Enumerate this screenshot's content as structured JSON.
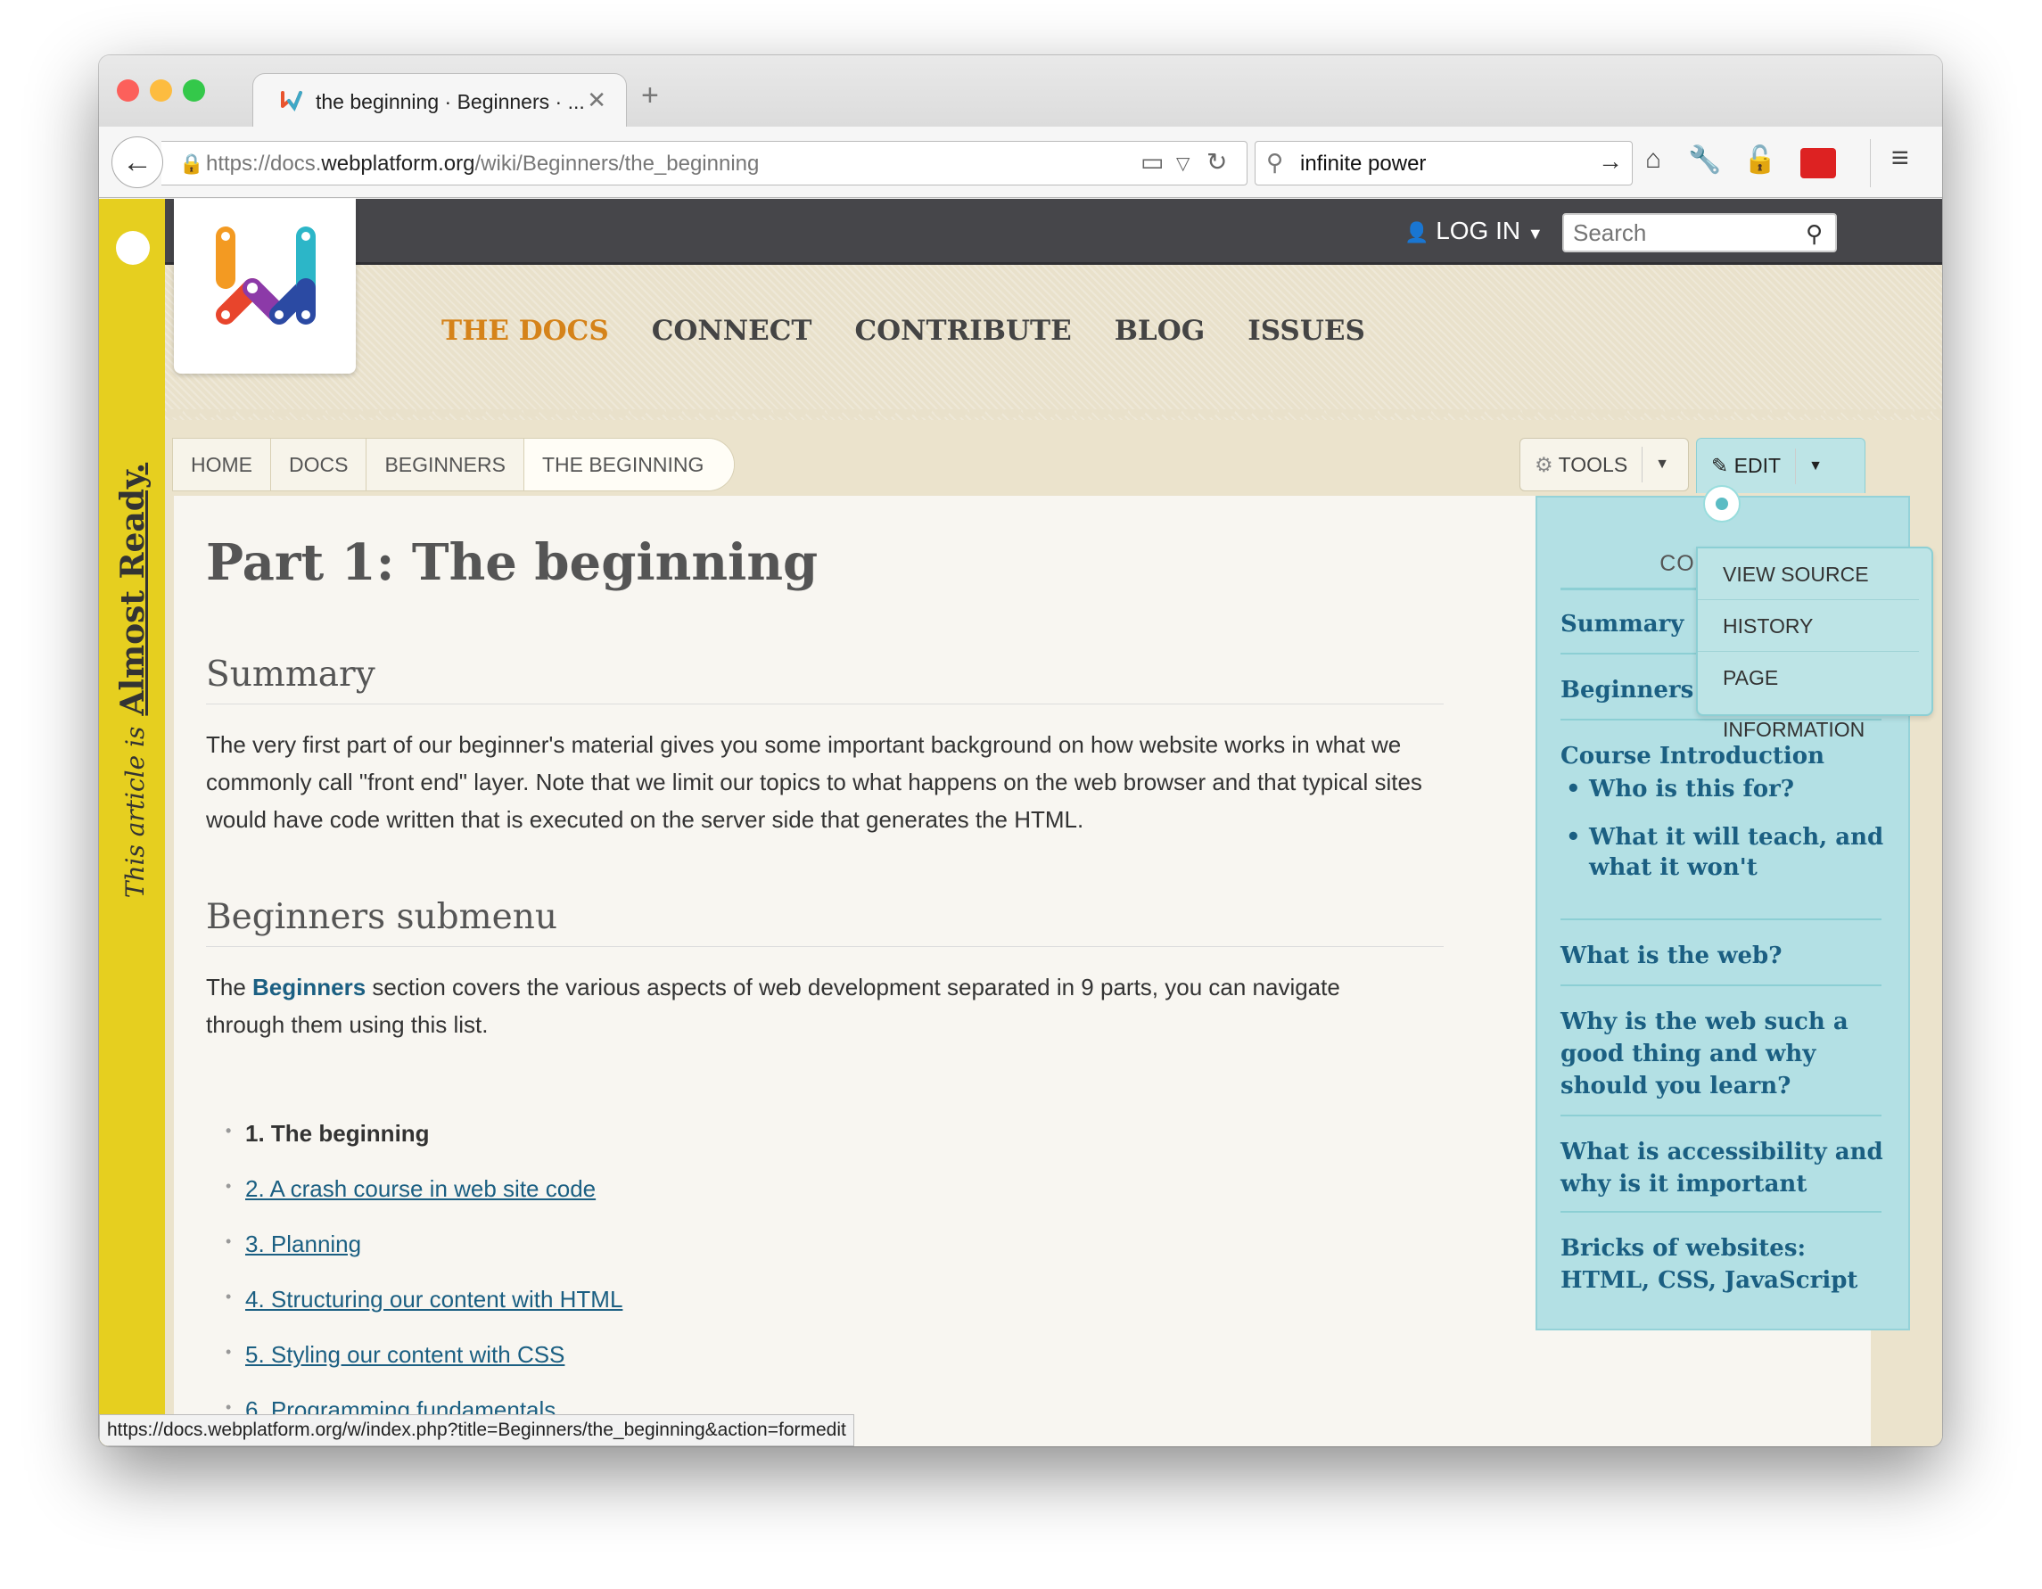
{
  "browser": {
    "tab_title": "the beginning · Beginners · ...",
    "url_prefix": "https://docs.",
    "url_domain": "webplatform.org",
    "url_path": "/wiki/Beginners/the_beginning",
    "search_value": "infinite power",
    "status_url": "https://docs.webplatform.org/w/index.php?title=Beginners/the_beginning&action=formedit",
    "colors": {
      "close": "#fc605b",
      "minimize": "#fdbc40",
      "zoom": "#34c84a"
    }
  },
  "site": {
    "login_label": "LOG IN",
    "search_placeholder": "Search",
    "nav": [
      "THE DOCS",
      "CONNECT",
      "CONTRIBUTE",
      "BLOG",
      "ISSUES"
    ],
    "ribbon_prefix": "This article is",
    "ribbon_status": "Almost Ready.",
    "breadcrumbs": [
      "HOME",
      "DOCS",
      "BEGINNERS",
      "THE BEGINNING"
    ],
    "tools_label": "TOOLS",
    "edit_label": "EDIT",
    "edit_menu": [
      "VIEW SOURCE",
      "HISTORY",
      "PAGE INFORMATION"
    ]
  },
  "article": {
    "title": "Part 1: The beginning",
    "summary_heading": "Summary",
    "summary_text": "The very first part of our beginner's material gives you some important background on how website works in what we commonly call \"front end\" layer. Note that we limit our topics to what happens on the web browser and that typical sites would have code written that is executed on the server side that generates the HTML.",
    "submenu_heading": "Beginners submenu",
    "submenu_text_before": "The ",
    "submenu_link": "Beginners",
    "submenu_text_after": " section covers the various aspects of web development separated in 9 parts, you can navigate through them using this list.",
    "parts": [
      "1. The beginning",
      "2. A crash course in web site code",
      "3. Planning",
      "4. Structuring our content with HTML",
      "5. Styling our content with CSS",
      "6. Programming fundamentals"
    ]
  },
  "toc": {
    "heading": "CONTENTS",
    "items": [
      "Summary",
      "Beginners submenu",
      "Course Introduction",
      "What is the web?",
      "Why is the web such a good thing and why should you learn?",
      "What is accessibility and why is it important",
      "Bricks of websites: HTML, CSS, JavaScript"
    ],
    "sub_items": [
      "Who is this for?",
      "What it will teach, and what it won't"
    ]
  }
}
